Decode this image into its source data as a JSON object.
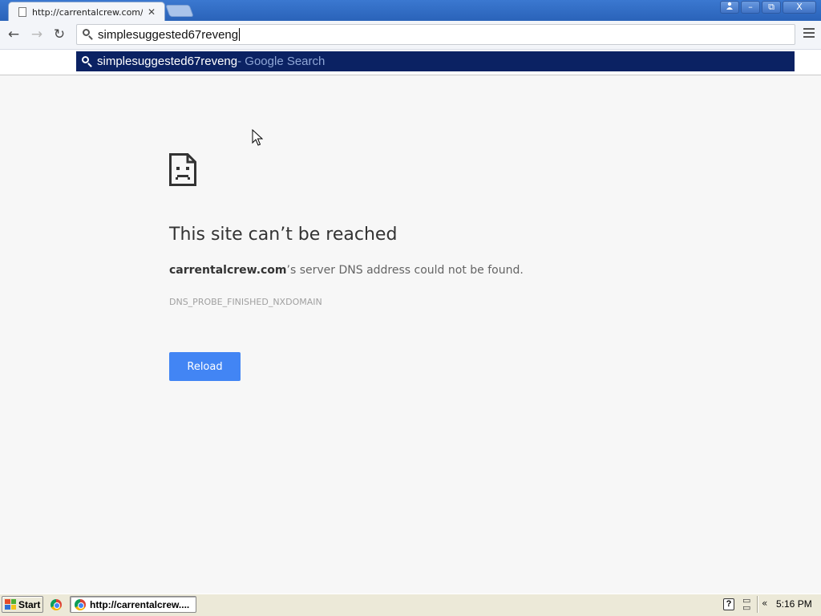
{
  "browser": {
    "tab_title": "http://carrentalcrew.com/store",
    "window_buttons": {
      "user": "",
      "minimize": "–",
      "restore": "⧉",
      "close": "X"
    }
  },
  "toolbar": {
    "back_icon": "←",
    "forward_icon": "→",
    "reload_icon": "↻",
    "address_value": "simplesuggested67reveng"
  },
  "suggestion": {
    "query": "simplesuggested67reveng",
    "suffix": " - Google Search"
  },
  "error_page": {
    "title": "This site can’t be reached",
    "domain": "carrentalcrew.com",
    "description_rest": "’s server DNS address could not be found.",
    "error_code": "DNS_PROBE_FINISHED_NXDOMAIN",
    "reload_label": "Reload"
  },
  "taskbar": {
    "start_label": "Start",
    "task_item_label": "http://carrentalcrew....",
    "tray_help": "?",
    "tray_chevron": "«",
    "clock": "5:16 PM"
  }
}
